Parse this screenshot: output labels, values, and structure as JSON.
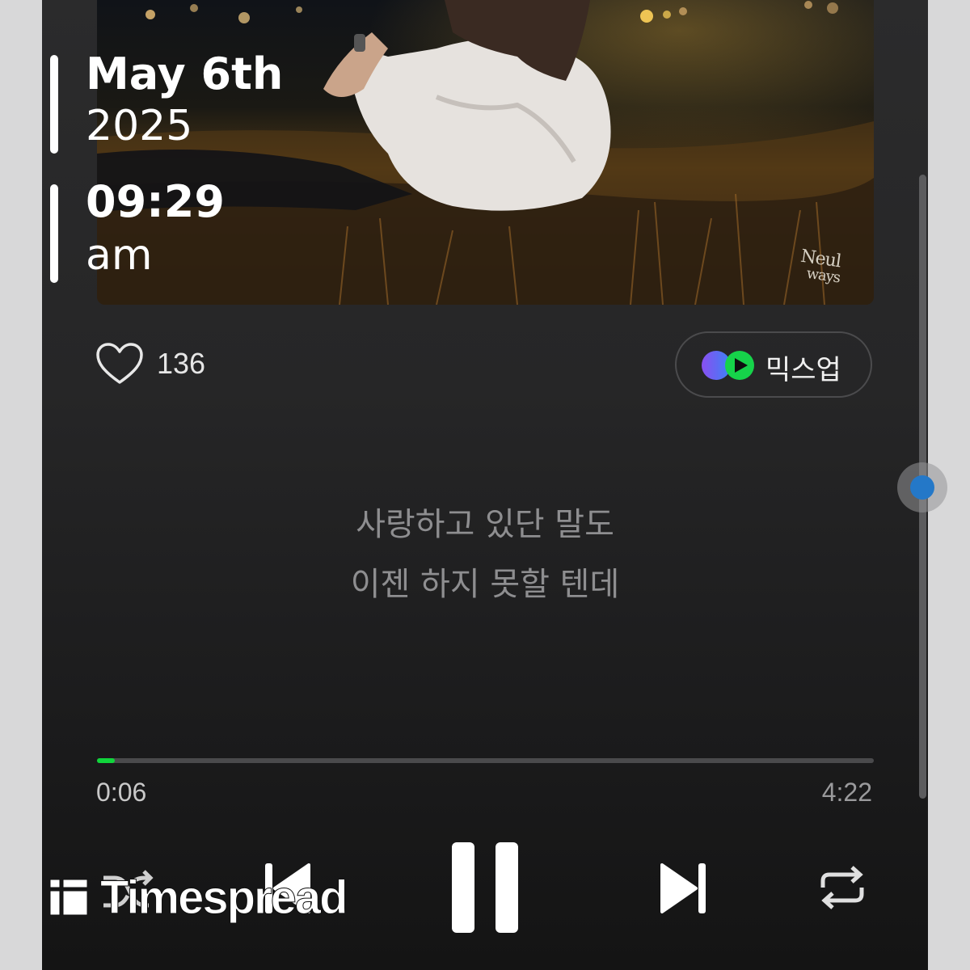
{
  "overlay": {
    "date": "May 6th",
    "year": "2025",
    "time": "09:29",
    "meridiem": "am"
  },
  "album_art": {
    "logo_line1": "Neul",
    "logo_line2": "ways"
  },
  "like": {
    "icon": "heart-outline-icon",
    "count": "136"
  },
  "mixup": {
    "icon": "mixup-logo-icon",
    "label": "믹스업",
    "colors": {
      "purple": "#7b5cf0",
      "blue": "#3b82f6",
      "green": "#16d34a"
    }
  },
  "lyrics": {
    "line1": "사랑하고 있단 말도",
    "line2": "이젠 하지 못할 텐데"
  },
  "playback": {
    "elapsed": "0:06",
    "total": "4:22",
    "progress_fraction": 0.023,
    "accent_color": "#10d53b"
  },
  "controls": {
    "shuffle_icon": "shuffle-icon",
    "previous_icon": "skip-previous-icon",
    "pause_icon": "pause-icon",
    "next_icon": "skip-next-icon",
    "repeat_icon": "repeat-icon"
  },
  "watermark": {
    "brand": "Timespread"
  }
}
